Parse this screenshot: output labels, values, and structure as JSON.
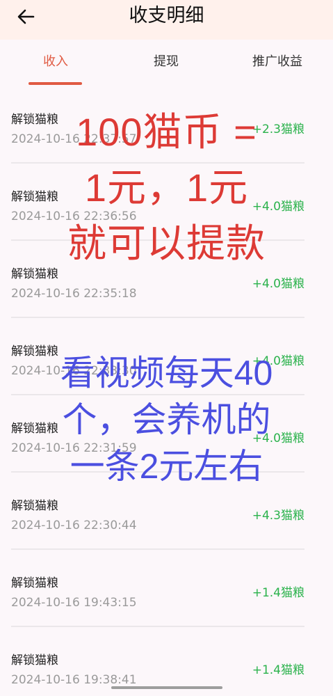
{
  "header": {
    "title": "收支明细",
    "back_icon": "arrow-left-icon"
  },
  "tabs": [
    {
      "label": "收入",
      "active": true
    },
    {
      "label": "提现",
      "active": false
    },
    {
      "label": "推广收益",
      "active": false
    }
  ],
  "records": [
    {
      "name": "解锁猫粮",
      "time": "2024-10-16 22:37:57",
      "amount": "+2.3猫粮"
    },
    {
      "name": "解锁猫粮",
      "time": "2024-10-16 22:36:56",
      "amount": "+4.0猫粮"
    },
    {
      "name": "解锁猫粮",
      "time": "2024-10-16 22:35:18",
      "amount": "+4.0猫粮"
    },
    {
      "name": "解锁猫粮",
      "time": "2024-10-16 22:33:30",
      "amount": "+4.0猫粮"
    },
    {
      "name": "解锁猫粮",
      "time": "2024-10-16 22:31:59",
      "amount": "+4.0猫粮"
    },
    {
      "name": "解锁猫粮",
      "time": "2024-10-16 22:30:44",
      "amount": "+4.3猫粮"
    },
    {
      "name": "解锁猫粮",
      "time": "2024-10-16 19:43:15",
      "amount": "+1.4猫粮"
    },
    {
      "name": "解锁猫粮",
      "time": "2024-10-16 19:38:41",
      "amount": "+1.4猫粮"
    }
  ],
  "overlay_red": {
    "line1": "100猫币 =",
    "line2": "1元，1元",
    "line3": "就可以提款"
  },
  "overlay_blue": {
    "line1": "看视频每天40",
    "line2": "个，会养机的",
    "line3": "一条2元左右"
  },
  "colors": {
    "accent": "#e05a42",
    "amount_green": "#2bb24c",
    "overlay_red": "#dd3a35",
    "overlay_blue": "#4b4fe0"
  }
}
